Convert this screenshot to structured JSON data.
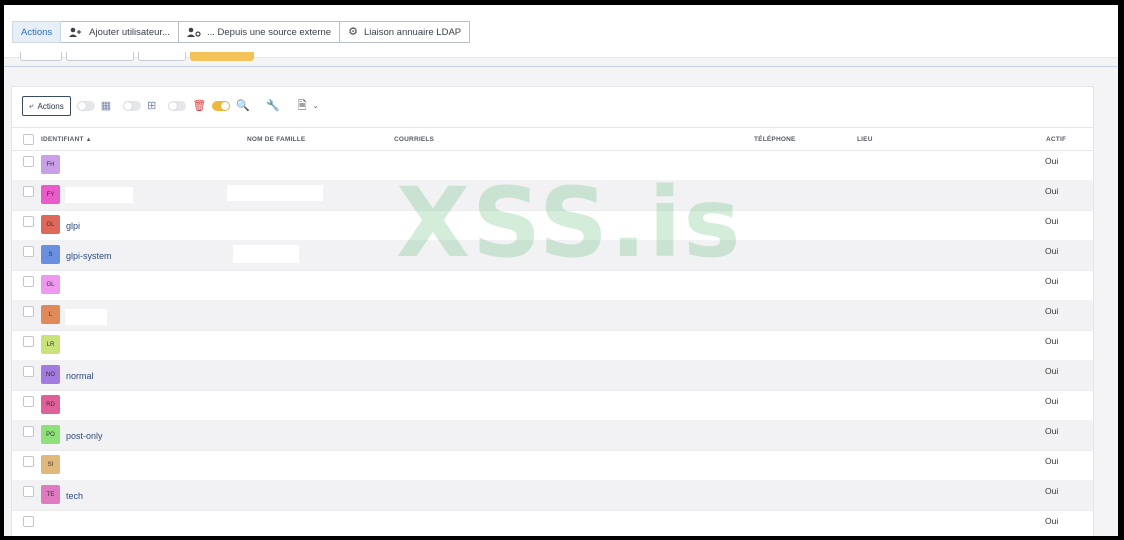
{
  "top_tabs": [
    {
      "label": "Actions",
      "icon": ""
    },
    {
      "label": "Ajouter utilisateur...",
      "icon": "user-plus-icon"
    },
    {
      "label": "... Depuis une source externe",
      "icon": "user-cog-icon"
    },
    {
      "label": "Liaison annuaire LDAP",
      "icon": "gear-icon"
    }
  ],
  "toolbar": {
    "actions_label": "Actions"
  },
  "table": {
    "headers": {
      "identifiant": "IDENTIFIANT",
      "nom": "NOM DE FAMILLE",
      "courriels": "COURRIELS",
      "telephone": "TÉLÉPHONE",
      "lieu": "LIEU",
      "actif": "ACTIF"
    },
    "rows": [
      {
        "initials": "FH",
        "color": "#c9a0e6",
        "name": "",
        "actif": "Oui"
      },
      {
        "initials": "FY",
        "color": "#e85bc8",
        "name": "",
        "actif": "Oui"
      },
      {
        "initials": "GL",
        "color": "#e0685a",
        "name": "glpi",
        "actif": "Oui"
      },
      {
        "initials": "S",
        "color": "#6b8fe0",
        "name": "glpi-system",
        "actif": "Oui"
      },
      {
        "initials": "GL",
        "color": "#ee98f0",
        "name": "",
        "actif": "Oui"
      },
      {
        "initials": "L",
        "color": "#e08a5a",
        "name": "",
        "actif": "Oui"
      },
      {
        "initials": "LR",
        "color": "#c9e27a",
        "name": "",
        "actif": "Oui"
      },
      {
        "initials": "NO",
        "color": "#a27ae0",
        "name": "normal",
        "actif": "Oui"
      },
      {
        "initials": "RD",
        "color": "#e0609a",
        "name": "",
        "actif": "Oui"
      },
      {
        "initials": "PO",
        "color": "#8ee07a",
        "name": "post-only",
        "actif": "Oui"
      },
      {
        "initials": "SI",
        "color": "#e0b87a",
        "name": "",
        "actif": "Oui"
      },
      {
        "initials": "TE",
        "color": "#e07ac0",
        "name": "tech",
        "actif": "Oui"
      },
      {
        "initials": "",
        "color": "",
        "name": "",
        "actif": "Oui"
      }
    ]
  },
  "watermark": "XSS.is"
}
